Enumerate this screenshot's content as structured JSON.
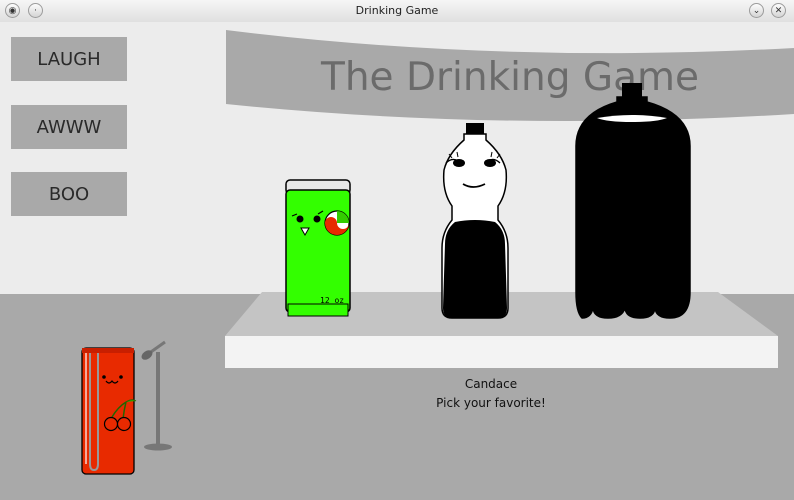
{
  "window": {
    "title": "Drinking Game"
  },
  "banner": {
    "title": "The Drinking Game"
  },
  "buttons": {
    "laugh": "LAUGH",
    "awww": "AWWW",
    "boo": "BOO"
  },
  "can": {
    "label": "12 oz"
  },
  "dialog": {
    "speaker": "Candace",
    "line": "Pick your favorite!"
  },
  "colors": {
    "banner": "#a9a9a9",
    "stage_top": "#c4c4c4",
    "stage_front": "#f3f3f3",
    "floor": "#a9a9a9",
    "can_green": "#33ff00",
    "juice_red": "#e82a00"
  },
  "icons": [
    "restore-icon",
    "minimize-icon",
    "chevron-down-icon",
    "close-icon",
    "cherry-icon",
    "microphone-icon"
  ]
}
